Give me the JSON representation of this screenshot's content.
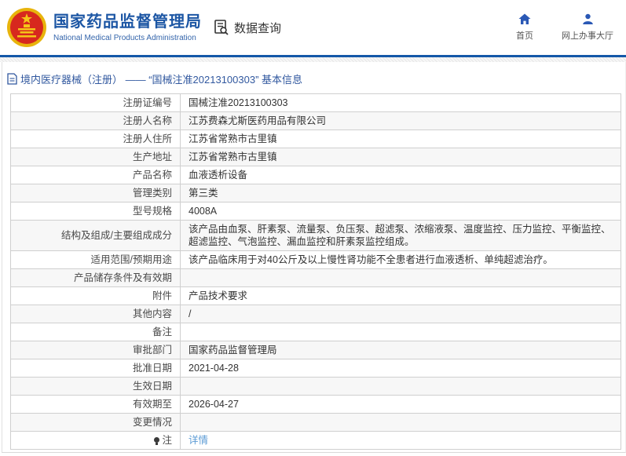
{
  "header": {
    "org_name_zh": "国家药品监督管理局",
    "org_name_en": "National Medical Products Administration",
    "query_label": "数据查询",
    "nav": [
      {
        "label": "首页",
        "icon": "home-icon"
      },
      {
        "label": "网上办事大厅",
        "icon": "person-icon"
      }
    ]
  },
  "breadcrumb": {
    "text": "境内医疗器械（注册） —— “国械注准20213100303” 基本信息",
    "icon": "document-icon"
  },
  "table": {
    "rows": [
      {
        "label": "注册证编号",
        "value": "国械注准20213100303",
        "type": "text"
      },
      {
        "label": "注册人名称",
        "value": "江苏费森尤斯医药用品有限公司",
        "type": "text"
      },
      {
        "label": "注册人住所",
        "value": "江苏省常熟市古里镇",
        "type": "text"
      },
      {
        "label": "生产地址",
        "value": "江苏省常熟市古里镇",
        "type": "text"
      },
      {
        "label": "产品名称",
        "value": "血液透析设备",
        "type": "text"
      },
      {
        "label": "管理类别",
        "value": "第三类",
        "type": "text"
      },
      {
        "label": "型号规格",
        "value": "4008A",
        "type": "text"
      },
      {
        "label": "结构及组成/主要组成成分",
        "value": "该产品由血泵、肝素泵、流量泵、负压泵、超滤泵、浓缩液泵、温度监控、压力监控、平衡监控、超滤监控、气泡监控、漏血监控和肝素泵监控组成。",
        "type": "text"
      },
      {
        "label": "适用范围/预期用途",
        "value": "该产品临床用于对40公斤及以上慢性肾功能不全患者进行血液透析、单纯超滤治疗。",
        "type": "text"
      },
      {
        "label": "产品储存条件及有效期",
        "value": "",
        "type": "empty"
      },
      {
        "label": "附件",
        "value": "产品技术要求",
        "type": "text"
      },
      {
        "label": "其他内容",
        "value": "/",
        "type": "text"
      },
      {
        "label": "备注",
        "value": "",
        "type": "empty"
      },
      {
        "label": "审批部门",
        "value": "国家药品监督管理局",
        "type": "text"
      },
      {
        "label": "批准日期",
        "value": "2021-04-28",
        "type": "text"
      },
      {
        "label": "生效日期",
        "value": "",
        "type": "empty"
      },
      {
        "label": "有效期至",
        "value": "2026-04-27",
        "type": "text"
      },
      {
        "label": "变更情况",
        "value": "",
        "type": "empty"
      },
      {
        "label": "注",
        "value": "详情",
        "type": "link",
        "label_icon": "note-icon"
      }
    ]
  },
  "colors": {
    "accent_blue": "#1c56a4",
    "separator_blue": "#1458a8",
    "link_blue": "#5b9bd5",
    "row_stripe": "#f7f7f7",
    "emblem_red": "#d7281e",
    "emblem_gold": "#e8b40c"
  }
}
